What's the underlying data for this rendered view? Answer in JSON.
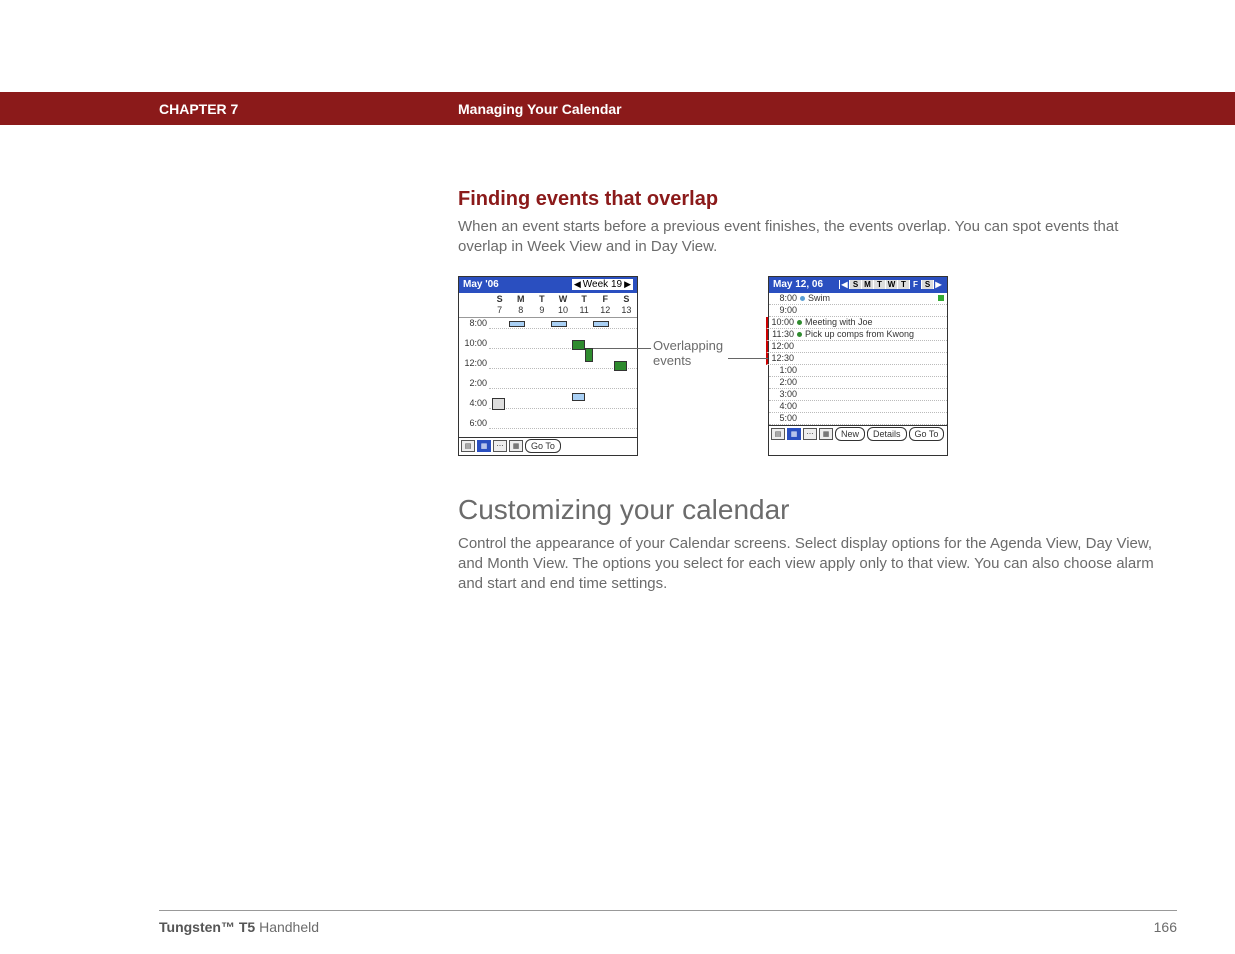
{
  "header": {
    "chapter": "CHAPTER 7",
    "title": "Managing Your Calendar"
  },
  "section1": {
    "heading": "Finding events that overlap",
    "body": "When an event starts before a previous event finishes, the events overlap. You can spot events that overlap in Week View and in Day View."
  },
  "callout": {
    "line1": "Overlapping",
    "line2": "events"
  },
  "weekview": {
    "title": "May '06",
    "weeklabel": "Week 19",
    "days": [
      "S",
      "M",
      "T",
      "W",
      "T",
      "F",
      "S"
    ],
    "dates": [
      "7",
      "8",
      "9",
      "10",
      "11",
      "12",
      "13"
    ],
    "times": [
      "8:00",
      "10:00",
      "12:00",
      "2:00",
      "4:00",
      "6:00"
    ],
    "goto": "Go To"
  },
  "dayview": {
    "title": "May 12, 06",
    "days": [
      "S",
      "M",
      "T",
      "W",
      "T",
      "F",
      "S"
    ],
    "rows": [
      {
        "t": "8:00",
        "dot": "b",
        "ev": "Swim",
        "note": true
      },
      {
        "t": "9:00",
        "dot": "",
        "ev": ""
      },
      {
        "t": "10:00",
        "dot": "g",
        "ev": "Meeting with Joe",
        "mark": true
      },
      {
        "t": "11:30",
        "dot": "g",
        "ev": "Pick up comps from Kwong",
        "mark": true
      },
      {
        "t": "12:00",
        "dot": "",
        "ev": "",
        "mark": true
      },
      {
        "t": "12:30",
        "dot": "",
        "ev": "",
        "mark": true
      },
      {
        "t": "1:00",
        "dot": "",
        "ev": ""
      },
      {
        "t": "2:00",
        "dot": "",
        "ev": ""
      },
      {
        "t": "3:00",
        "dot": "",
        "ev": ""
      },
      {
        "t": "4:00",
        "dot": "",
        "ev": ""
      },
      {
        "t": "5:00",
        "dot": "",
        "ev": ""
      }
    ],
    "buttons": {
      "new": "New",
      "details": "Details",
      "goto": "Go To"
    }
  },
  "section2": {
    "heading": "Customizing your calendar",
    "body": "Control the appearance of your Calendar screens. Select display options for the Agenda View, Day View, and Month View. The options you select for each view apply only to that view. You can also choose alarm and start and end time settings."
  },
  "footer": {
    "product_bold": "Tungsten™ T5",
    "product_rest": " Handheld",
    "page": "166"
  }
}
